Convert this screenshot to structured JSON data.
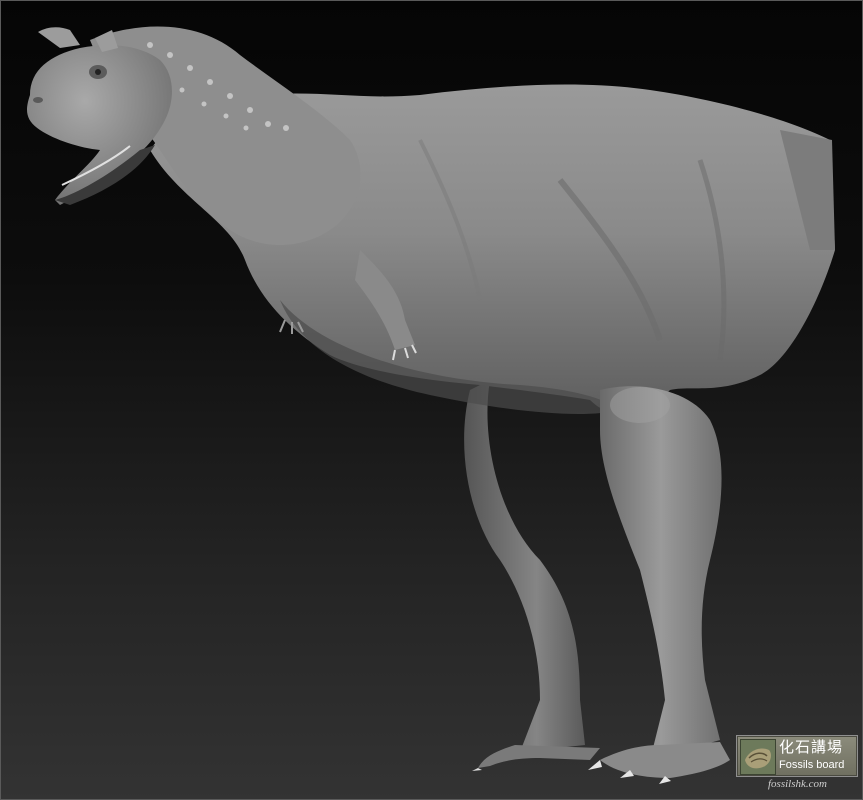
{
  "image": {
    "subject": "carnotaurus-sculpt",
    "background_colors": [
      "#050505",
      "#333333"
    ],
    "model_color": "#8a8a8a"
  },
  "watermark": {
    "title": "化石講場",
    "subtitle": "Fossils board",
    "url": "fossilshk.com"
  }
}
